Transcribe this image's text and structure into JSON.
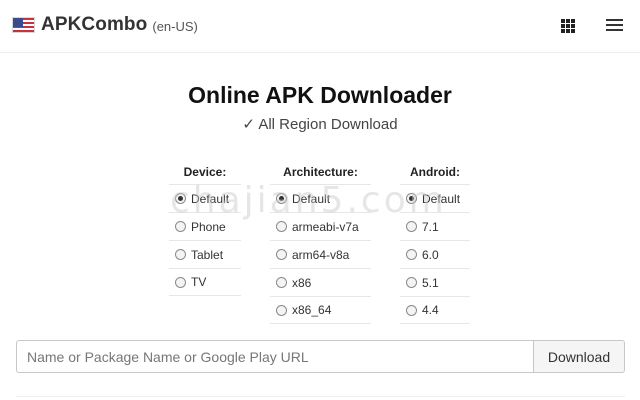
{
  "header": {
    "brand": "APKCombo",
    "locale": "(en-US)",
    "flag_icon": "us-flag-icon",
    "grid_icon": "apps-grid-icon",
    "menu_icon": "hamburger-menu-icon"
  },
  "main": {
    "title": "Online APK Downloader",
    "subtitle": "✓ All Region Download"
  },
  "options": {
    "device": {
      "heading": "Device:",
      "items": [
        "Default",
        "Phone",
        "Tablet",
        "TV"
      ],
      "selected": "Default"
    },
    "architecture": {
      "heading": "Architecture:",
      "items": [
        "Default",
        "armeabi-v7a",
        "arm64-v8a",
        "x86",
        "x86_64"
      ],
      "selected": "Default"
    },
    "android": {
      "heading": "Android:",
      "items": [
        "Default",
        "7.1",
        "6.0",
        "5.1",
        "4.4"
      ],
      "selected": "Default"
    }
  },
  "search": {
    "placeholder": "Name or Package Name or Google Play URL",
    "value": "",
    "button_label": "Download"
  },
  "watermark": "chajian5.com"
}
